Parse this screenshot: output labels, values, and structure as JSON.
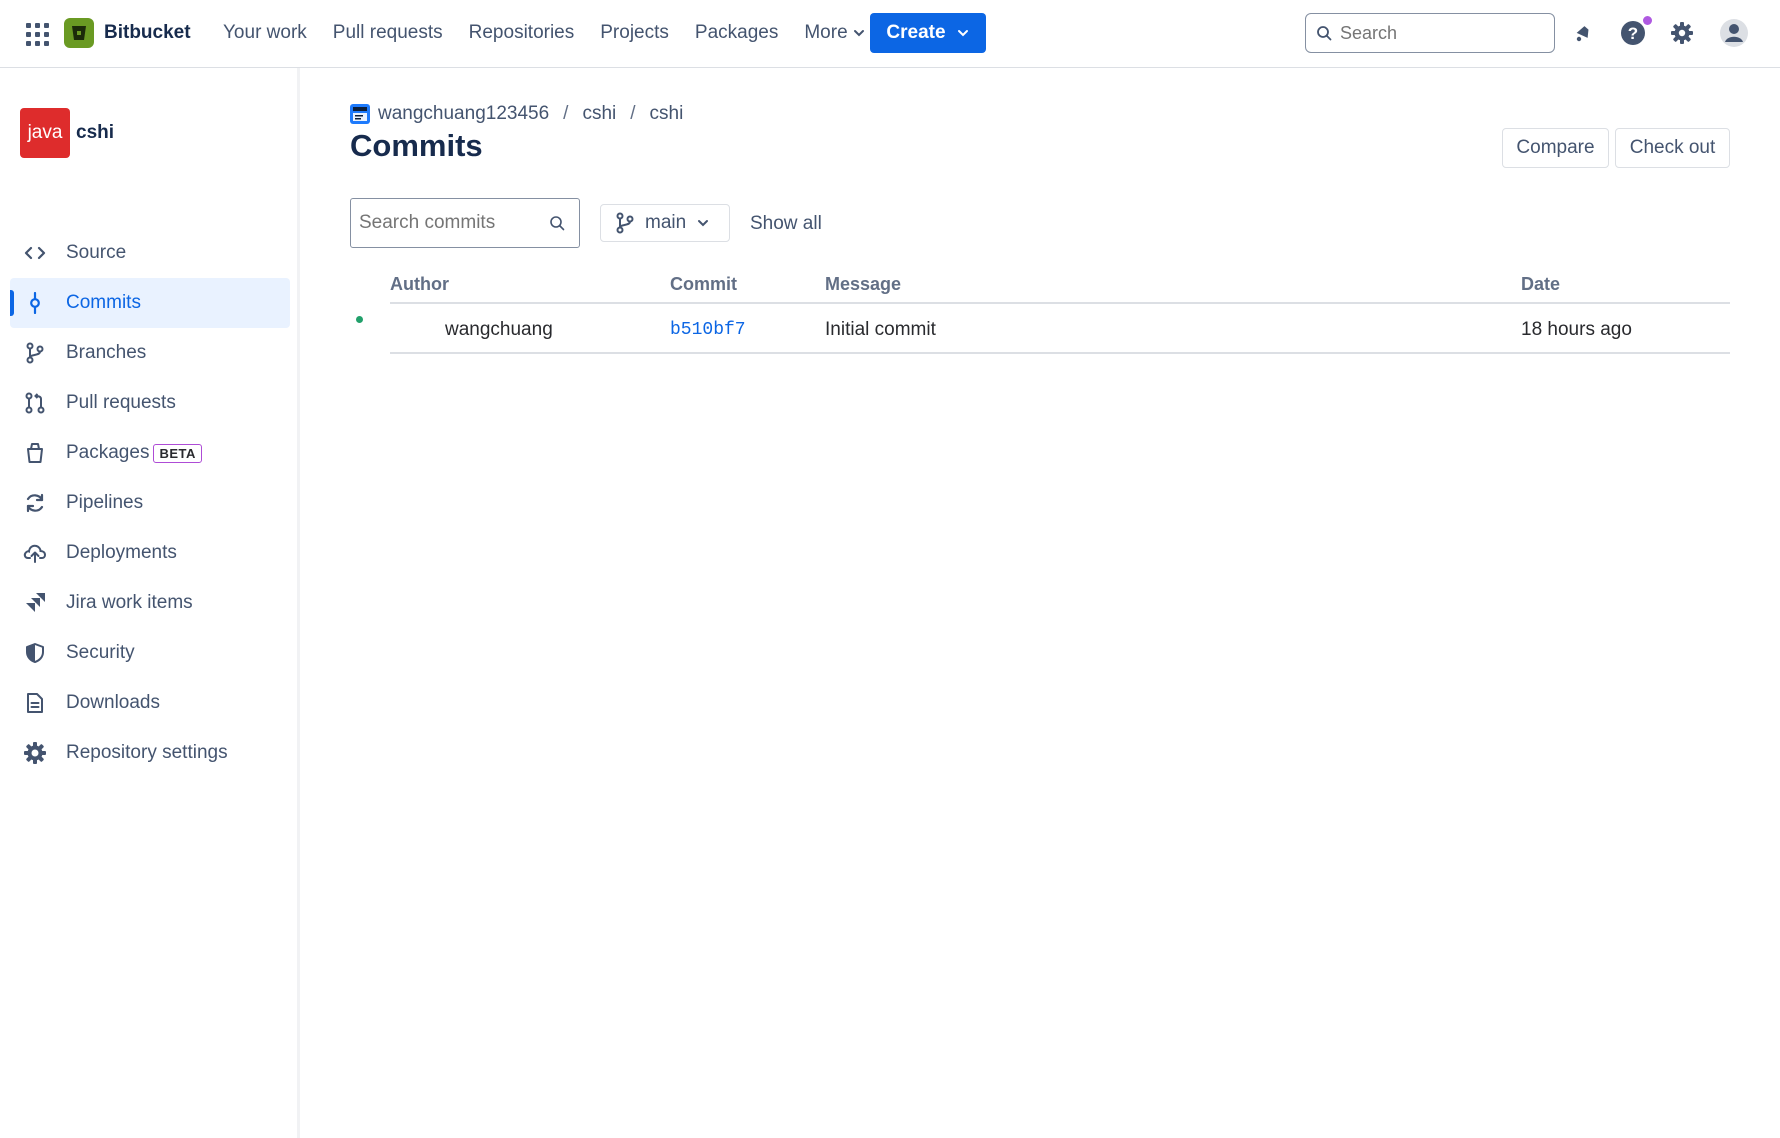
{
  "topnav": {
    "logo_text": "Bitbucket",
    "links": [
      "Your work",
      "Pull requests",
      "Repositories",
      "Projects",
      "Packages"
    ],
    "more_label": "More",
    "create_label": "Create",
    "search_placeholder": "Search",
    "accent_color": "#0c66e4"
  },
  "sidebar": {
    "repo_avatar_text": "java",
    "repo_name": "cshi",
    "items": [
      {
        "label": "Source",
        "icon": "code-icon"
      },
      {
        "label": "Commits",
        "icon": "commit-icon",
        "active": true
      },
      {
        "label": "Branches",
        "icon": "branch-icon"
      },
      {
        "label": "Pull requests",
        "icon": "pull-request-icon"
      },
      {
        "label": "Packages",
        "icon": "package-icon",
        "badge": "BETA"
      },
      {
        "label": "Pipelines",
        "icon": "pipelines-icon"
      },
      {
        "label": "Deployments",
        "icon": "cloud-upload-icon"
      },
      {
        "label": "Jira work items",
        "icon": "jira-icon"
      },
      {
        "label": "Security",
        "icon": "shield-icon"
      },
      {
        "label": "Downloads",
        "icon": "file-icon"
      },
      {
        "label": "Repository settings",
        "icon": "gear-icon"
      }
    ]
  },
  "main": {
    "breadcrumb": [
      "wangchuang123456",
      "cshi",
      "cshi"
    ],
    "title": "Commits",
    "compare_label": "Compare",
    "checkout_label": "Check out",
    "search_placeholder": "Search commits",
    "branch": "main",
    "show_all_label": "Show all",
    "columns": [
      "Author",
      "Commit",
      "Message",
      "Date"
    ],
    "rows": [
      {
        "author": "wangchuang",
        "commit": "b510bf7",
        "message": "Initial commit",
        "date": "18 hours ago"
      }
    ]
  }
}
